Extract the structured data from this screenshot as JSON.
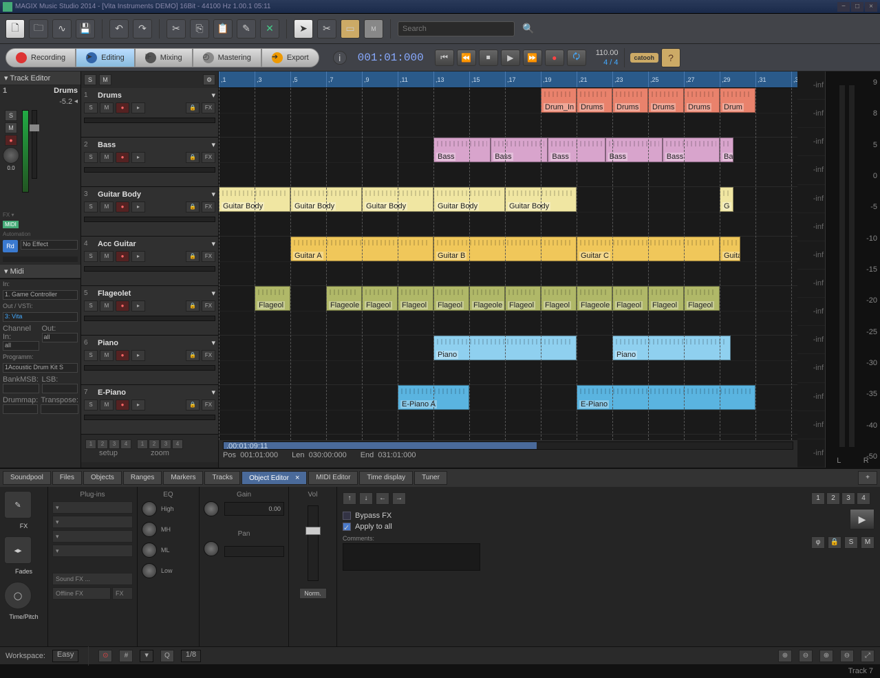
{
  "title": "MAGIX Music Studio 2014 - [Vita Instruments DEMO] 16Bit - 44100 Hz 1.00.1 05:11",
  "toolbar": {
    "search_ph": "Search"
  },
  "modes": {
    "recording": "Recording",
    "editing": "Editing",
    "mixing": "Mixing",
    "mastering": "Mastering",
    "export": "Export"
  },
  "transport": {
    "position": "001:01:000",
    "tempo": "110.00",
    "sig": "4 / 4"
  },
  "trackEditor": {
    "title": "Track Editor",
    "num": "1",
    "name": "Drums",
    "db": "-5.2",
    "pan": "0.0",
    "automation": "Automation",
    "noeffect": "No Effect",
    "rd": "Rd",
    "midi_lbl": "MIDI"
  },
  "midi": {
    "title": "Midi",
    "in_lbl": "In:",
    "in_val": "1. Game Controller",
    "out_lbl": "Out / VSTi:",
    "out_val": "3: Vita",
    "ch_in_lbl": "Channel In:",
    "ch_in": "all",
    "ch_out_lbl": "Out:",
    "ch_out": "all",
    "prog_lbl": "Programm:",
    "prog": "1Acoustic Drum Kit S",
    "bank_lbl": "BankMSB:",
    "lsb_lbl": "LSB:",
    "drummap_lbl": "Drummap:",
    "transp_lbl": "Transpose:"
  },
  "tracks": [
    {
      "n": "1",
      "name": "Drums"
    },
    {
      "n": "2",
      "name": "Bass"
    },
    {
      "n": "3",
      "name": "Guitar Body"
    },
    {
      "n": "4",
      "name": "Acc Guitar"
    },
    {
      "n": "5",
      "name": "Flageolet"
    },
    {
      "n": "6",
      "name": "Piano"
    },
    {
      "n": "7",
      "name": "E-Piano"
    }
  ],
  "trackFooter": {
    "setup": "setup",
    "zoom": "zoom"
  },
  "rulerStart": 1,
  "clips": {
    "drums": [
      {
        "l": "Drum_In"
      },
      {
        "l": "Drums"
      },
      {
        "l": "Drums"
      },
      {
        "l": "Drums"
      },
      {
        "l": "Drums"
      },
      {
        "l": "Drum"
      }
    ],
    "bass": [
      {
        "l": "Bass"
      },
      {
        "l": "Bass"
      },
      {
        "l": "Bass"
      },
      {
        "l": "Bass"
      },
      {
        "l": "Bass"
      },
      {
        "l": "Ba"
      }
    ],
    "gbody": [
      {
        "l": "Guitar Body"
      },
      {
        "l": "Guitar Body"
      },
      {
        "l": "Guitar Body"
      },
      {
        "l": "Guitar Body"
      },
      {
        "l": "Guitar Body"
      },
      {
        "l": "G"
      }
    ],
    "acc": [
      {
        "l": "Guitar A"
      },
      {
        "l": "Guitar B"
      },
      {
        "l": "Guitar C"
      },
      {
        "l": "Guitar"
      }
    ],
    "flag": [
      {
        "l": "Flageol"
      },
      {
        "l": "Flageole"
      },
      {
        "l": "Flageol"
      },
      {
        "l": "Flageol"
      },
      {
        "l": "Flageol"
      },
      {
        "l": "Flageole"
      },
      {
        "l": "Flageol"
      },
      {
        "l": "Flageol"
      },
      {
        "l": "Flageole"
      },
      {
        "l": "Flageol"
      },
      {
        "l": "Flageol"
      },
      {
        "l": "Flageol"
      }
    ],
    "piano": [
      {
        "l": "Piano"
      },
      {
        "l": "Piano"
      }
    ],
    "epiano": [
      {
        "l": "E-Piano A"
      },
      {
        "l": "E-Piano"
      }
    ]
  },
  "arrFooter": {
    "scroll_time": ".00:01:09:11",
    "pos_lbl": "Pos",
    "pos": "001:01:000",
    "len_lbl": "Len",
    "len": "030:00:000",
    "end_lbl": "End",
    "end": "031:01:000"
  },
  "db_labels": [
    "-inf",
    "-inf",
    "-inf",
    "-inf",
    "-inf",
    "-inf",
    "-inf",
    "-inf",
    "-inf",
    "-inf",
    "-inf",
    "-inf",
    "-inf",
    "-inf"
  ],
  "meter_scale": [
    "9",
    "8",
    "5",
    "0",
    "-5",
    "-10",
    "-15",
    "-20",
    "-25",
    "-30",
    "-35",
    "-40",
    "-50"
  ],
  "dock": {
    "tabs": [
      "Soundpool",
      "Files",
      "Objects",
      "Ranges",
      "Markers",
      "Tracks",
      "Object Editor",
      "MIDI Editor",
      "Time display",
      "Tuner"
    ],
    "active": 6,
    "plugins_lbl": "Plug-ins",
    "eq_lbl": "EQ",
    "gain_lbl": "Gain",
    "vol_lbl": "Vol",
    "pan_lbl": "Pan",
    "fx": "FX",
    "fades": "Fades",
    "timepitch": "Time/Pitch",
    "sfx": "Sound FX ...",
    "offline": "Offline FX",
    "fxbtn": "FX",
    "high": "High",
    "mh": "MH",
    "ml": "ML",
    "low": "Low",
    "gain_val": "0.00",
    "norm": "Norm.",
    "bypass": "Bypass FX",
    "applyall": "Apply to all",
    "comments": "Comments:",
    "nums": [
      "1",
      "2",
      "3",
      "4"
    ],
    "sm_s": "S",
    "sm_m": "M"
  },
  "status": {
    "ws_lbl": "Workspace:",
    "ws": "Easy",
    "snap": "1/8",
    "footer": "Track 7"
  }
}
